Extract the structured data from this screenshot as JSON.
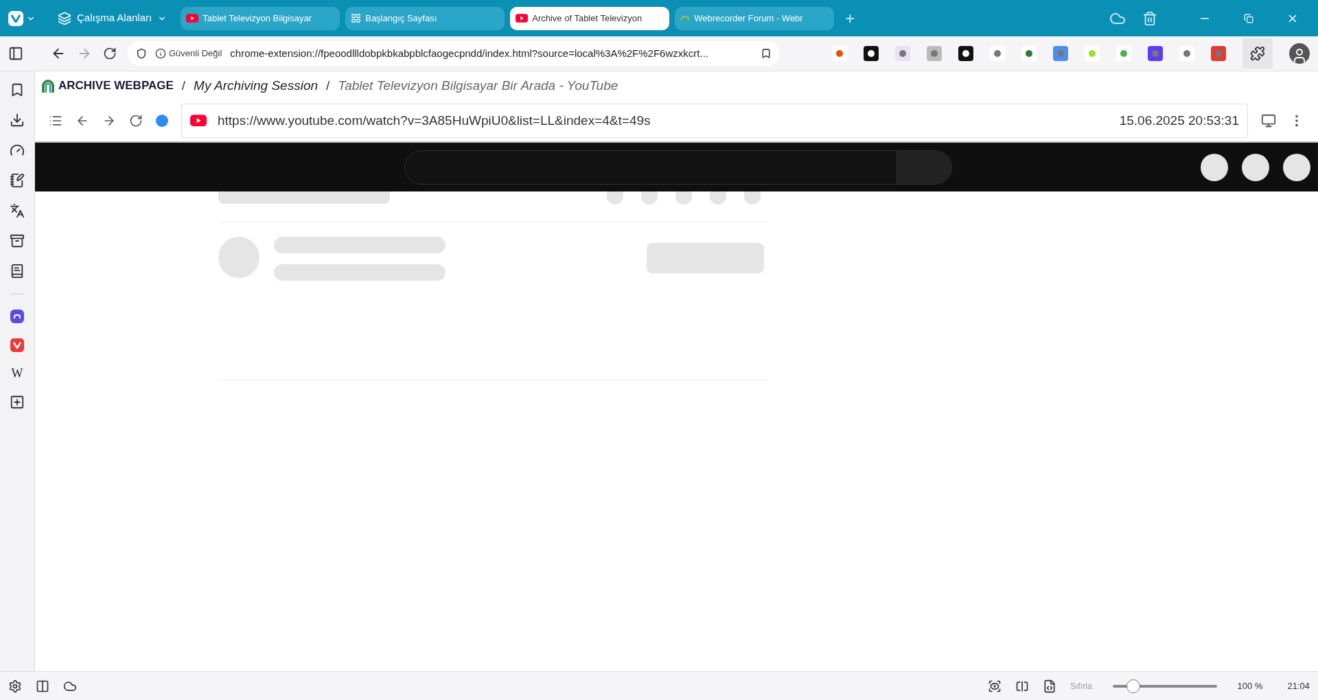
{
  "tab_bar": {
    "workspaces": "Çalışma Alanları",
    "tabs": [
      {
        "label": "Tablet Televizyon Bilgisayar",
        "kind": "youtube",
        "selected": false
      },
      {
        "label": "Başlangıç Sayfası",
        "kind": "grid",
        "selected": false
      },
      {
        "label": "Archive of Tablet Televizyon",
        "kind": "youtube",
        "selected": true
      },
      {
        "label": "Webrecorder Forum - Webr",
        "kind": "webrecorder",
        "selected": false
      }
    ],
    "new_tab": "+"
  },
  "address_bar": {
    "security": "Güvenli Değil",
    "url": "chrome-extension://fpeoodllldobpkbkabpblcfaogecpndd/index.html?source=local%3A%2F%2F6wzxkcrt..."
  },
  "archive": {
    "brand": "ARCHIVE WEBPAGE",
    "breadcrumbs": [
      {
        "separator": "/",
        "label": "My Archiving Session"
      },
      {
        "separator": "/",
        "label": "Tablet Televizyon Bilgisayar Bir Arada - YouTube"
      }
    ],
    "url": "https://www.youtube.com/watch?v=3A85HuWpiU0&list=LL&index=4&t=49s",
    "timestamp": "15.06.2025 20:53:31"
  },
  "sidebar": {
    "wiki": "W"
  },
  "status_bar": {
    "reset": "Sıfırla",
    "zoom": {
      "level": 0.2,
      "reading": "100 %"
    },
    "time": "21:04"
  }
}
